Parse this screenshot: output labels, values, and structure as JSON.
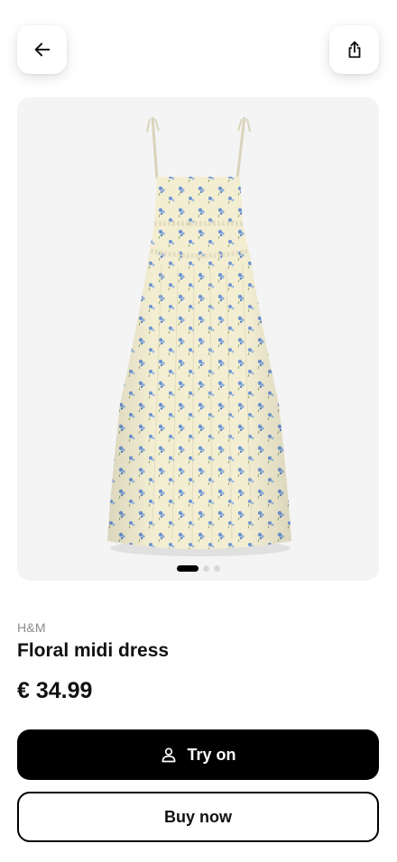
{
  "header": {
    "back_icon": "arrow-left-icon",
    "share_icon": "share-icon"
  },
  "gallery": {
    "image_name": "floral-midi-dress-photo",
    "dot_count": 3,
    "active_index": 0
  },
  "product": {
    "brand": "H&M",
    "title": "Floral midi dress",
    "price": "€ 34.99"
  },
  "actions": {
    "try_on_label": "Try on",
    "try_on_icon": "person-icon",
    "buy_now_label": "Buy now"
  },
  "colors": {
    "primary": "#000000",
    "card_background": "#f4f4f5",
    "dress_fabric": "#f3eed2",
    "flower_blue": "#6f95cf",
    "muted_text": "#8a8a8a"
  }
}
